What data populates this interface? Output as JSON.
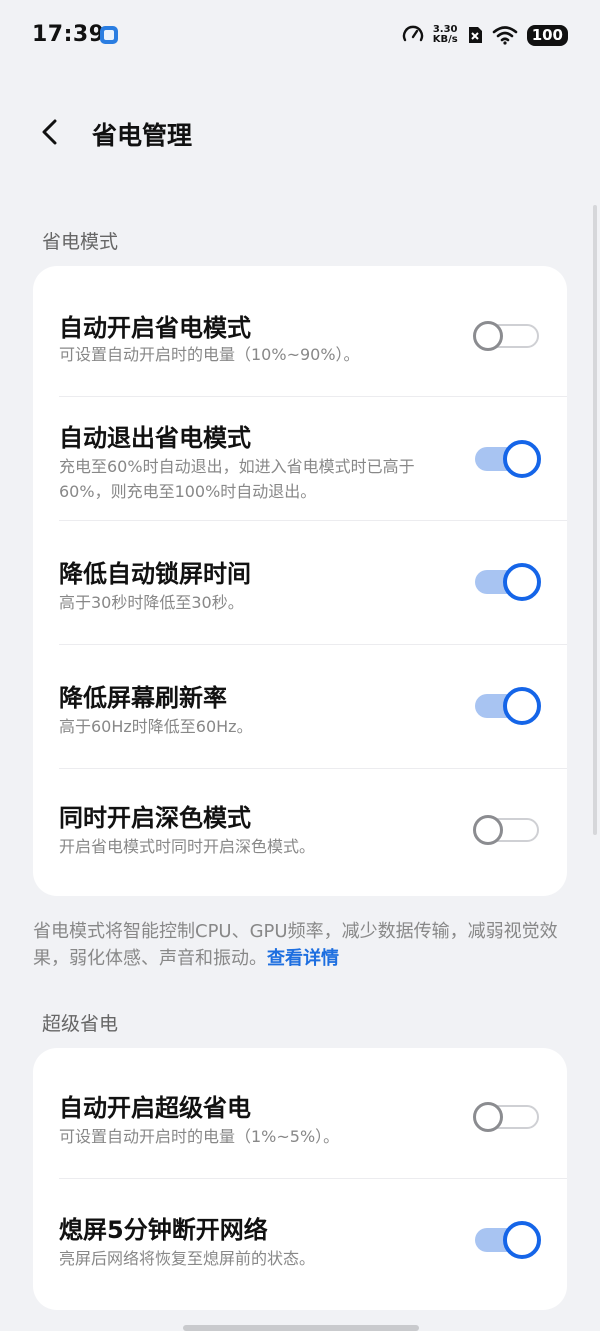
{
  "status_bar": {
    "time": "17:39",
    "speed_top": "3.30",
    "speed_bottom": "KB/s",
    "battery": "100",
    "icons": [
      "app-notification-icon",
      "speedometer-icon",
      "no-sim-icon",
      "wifi-icon",
      "battery-icon"
    ]
  },
  "nav": {
    "back_icon": "chevron-left-icon",
    "title": "省电管理"
  },
  "sections": [
    {
      "label": "省电模式",
      "rows": [
        {
          "title": "自动开启省电模式",
          "desc": "可设置自动开启时的电量（10%~90%）。",
          "on": false
        },
        {
          "title": "自动退出省电模式",
          "desc": "充电至60%时自动退出，如进入省电模式时已高于60%，则充电至100%时自动退出。",
          "on": true
        },
        {
          "title": "降低自动锁屏时间",
          "desc": "高于30秒时降低至30秒。",
          "on": true
        },
        {
          "title": "降低屏幕刷新率",
          "desc": "高于60Hz时降低至60Hz。",
          "on": true
        },
        {
          "title": "同时开启深色模式",
          "desc": "开启省电模式时同时开启深色模式。",
          "on": false
        }
      ]
    },
    {
      "label": "超级省电",
      "rows": [
        {
          "title": "自动开启超级省电",
          "desc": "可设置自动开启时的电量（1%~5%）。",
          "on": false
        },
        {
          "title": "熄屏5分钟断开网络",
          "desc": "亮屏后网络将恢复至熄屏前的状态。",
          "on": true
        }
      ]
    }
  ],
  "footnote": {
    "text": "省电模式将智能控制CPU、GPU频率，减少数据传输，减弱视觉效果，弱化体感、声音和振动。",
    "link": "查看详情"
  },
  "colors": {
    "accent": "#1565e8",
    "track_on": "#a8c4f2",
    "background": "#f1f2f5"
  }
}
